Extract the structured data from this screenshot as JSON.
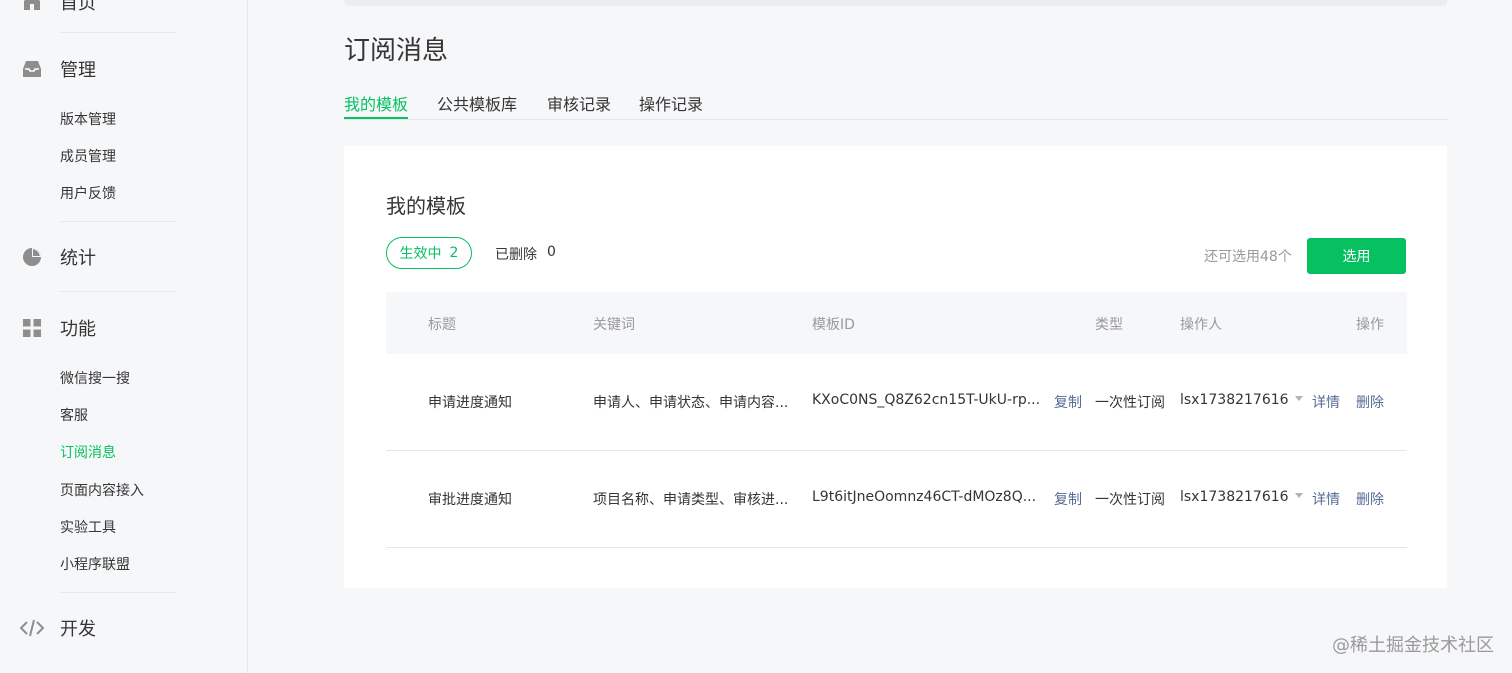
{
  "sidebar": {
    "home": {
      "label": "首页",
      "icon": "home-icon"
    },
    "manage": {
      "label": "管理",
      "icon": "inbox-icon"
    },
    "manage_items": [
      "版本管理",
      "成员管理",
      "用户反馈"
    ],
    "stats": {
      "label": "统计",
      "icon": "pie-chart-icon"
    },
    "features": {
      "label": "功能",
      "icon": "grid-icon"
    },
    "feature_items": [
      "微信搜一搜",
      "客服",
      "订阅消息",
      "页面内容接入",
      "实验工具",
      "小程序联盟"
    ],
    "active_item": "订阅消息",
    "dev": {
      "label": "开发",
      "icon": "code-icon"
    }
  },
  "page": {
    "title": "订阅消息",
    "tabs": [
      "我的模板",
      "公共模板库",
      "审核记录",
      "操作记录"
    ],
    "active_tab": "我的模板"
  },
  "card": {
    "title": "我的模板",
    "active_filter": {
      "label": "生效中",
      "count": "2"
    },
    "deleted_filter": {
      "label": "已删除",
      "count": "0"
    },
    "remaining_text": "还可选用48个",
    "select_button": "选用"
  },
  "table": {
    "headers": {
      "title": "标题",
      "keywords": "关键词",
      "template_id": "模板ID",
      "type": "类型",
      "operator": "操作人",
      "action": "操作"
    },
    "rows": [
      {
        "title": "申请进度通知",
        "keywords": "申请人、申请状态、申请内容...",
        "template_id": "KXoC0NS_Q8Z62cn15T-UkU-rp...",
        "copy": "复制",
        "type": "一次性订阅",
        "operator": "lsx1738217616",
        "detail": "详情",
        "delete": "删除"
      },
      {
        "title": "审批进度通知",
        "keywords": "项目名称、申请类型、审核进...",
        "template_id": "L9t6itJneOomnz46CT-dMOz8Q...",
        "copy": "复制",
        "type": "一次性订阅",
        "operator": "lsx1738217616",
        "detail": "详情",
        "delete": "删除"
      }
    ]
  },
  "watermark": "@稀土掘金技术社区",
  "colors": {
    "accent": "#07c160",
    "link": "#576b95",
    "muted": "#9a9a9a"
  }
}
